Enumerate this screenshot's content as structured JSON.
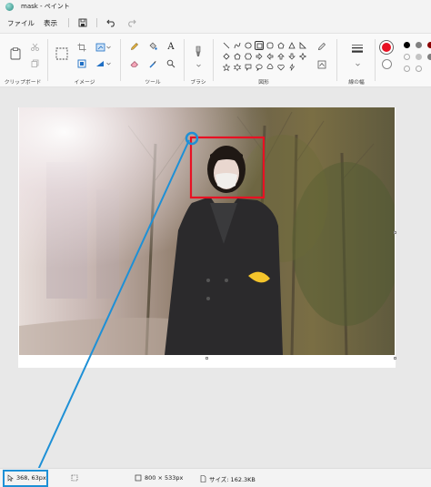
{
  "window": {
    "title": "mask - ペイント"
  },
  "menu": {
    "file": "ファイル",
    "view": "表示"
  },
  "ribbon": {
    "groups": {
      "clipboard": "クリップボード",
      "image": "イメージ",
      "tools": "ツール",
      "brushes": "ブラシ",
      "shapes": "図形",
      "size": "線の幅"
    }
  },
  "colors": {
    "primary": "#e81123",
    "secondary": "#ffffff",
    "palette": [
      "#000000",
      "#808080",
      "#8b0000",
      "#c3c3c3",
      "#7f7f7f"
    ],
    "annotation_red": "#e81123",
    "annotation_blue": "#1e90d6"
  },
  "status": {
    "cursor_position": "368, 63px",
    "canvas_size": "800 × 533px",
    "file_size": "サイズ: 162.3KB"
  }
}
